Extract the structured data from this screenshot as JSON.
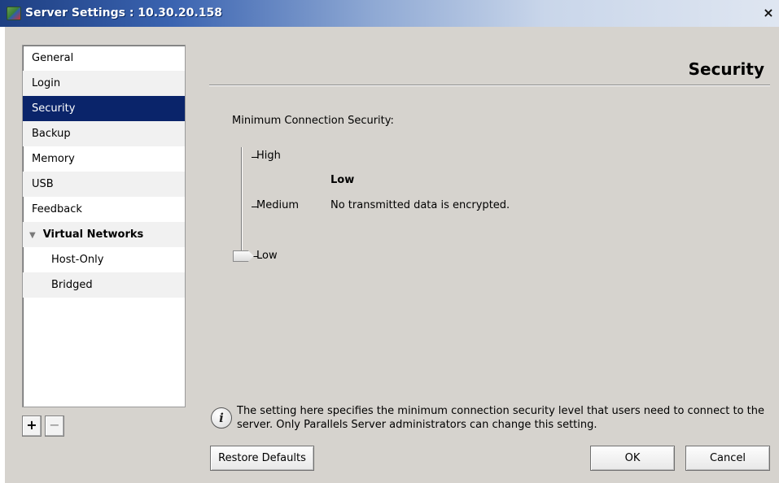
{
  "window": {
    "title": "Server Settings : 10.30.20.158",
    "close_glyph": "×",
    "icon": "parallels-app-icon"
  },
  "sidebar": {
    "items": [
      {
        "label": "General"
      },
      {
        "label": "Login"
      },
      {
        "label": "Security"
      },
      {
        "label": "Backup"
      },
      {
        "label": "Memory"
      },
      {
        "label": "USB"
      },
      {
        "label": "Feedback"
      },
      {
        "label": "Virtual Networks"
      },
      {
        "label": "Host-Only"
      },
      {
        "label": "Bridged"
      }
    ],
    "selected": "Security",
    "add_label": "+",
    "remove_label": "−"
  },
  "main": {
    "section_title": "Security",
    "min_label": "Minimum Connection Security:",
    "slider": {
      "levels": [
        "High",
        "Medium",
        "Low"
      ],
      "value": "Low"
    },
    "level_name": "Low",
    "level_description": "No transmitted data is encrypted.",
    "info_text": "The setting here specifies the minimum connection security level that users need to connect to the server. Only Parallels Server administrators can change this setting."
  },
  "buttons": {
    "restore": "Restore Defaults",
    "ok": "OK",
    "cancel": "Cancel"
  },
  "colors": {
    "selection": "#0a246a",
    "dialog_bg": "#d6d3ce"
  }
}
